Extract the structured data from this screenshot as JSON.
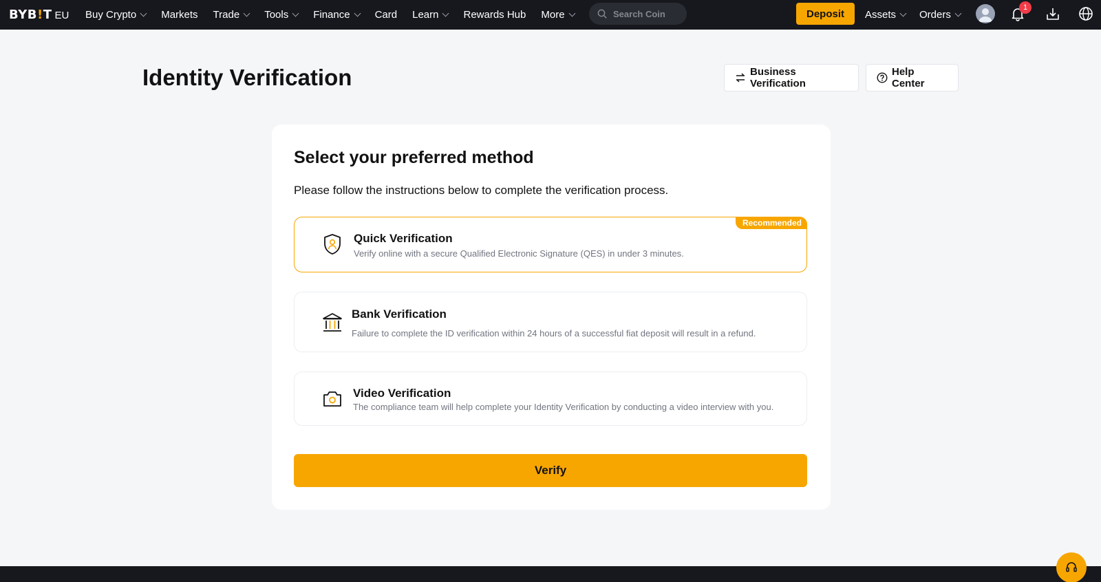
{
  "logo": {
    "brand_left": "BYB",
    "brand_dot": "!",
    "brand_right": "T",
    "region": "EU"
  },
  "nav": {
    "items": [
      {
        "label": "Buy Crypto",
        "dropdown": true
      },
      {
        "label": "Markets",
        "dropdown": false
      },
      {
        "label": "Trade",
        "dropdown": true
      },
      {
        "label": "Tools",
        "dropdown": true
      },
      {
        "label": "Finance",
        "dropdown": true
      },
      {
        "label": "Card",
        "dropdown": false
      },
      {
        "label": "Learn",
        "dropdown": true
      },
      {
        "label": "Rewards Hub",
        "dropdown": false
      },
      {
        "label": "More",
        "dropdown": true
      }
    ],
    "search_placeholder": "Search Coin",
    "deposit_label": "Deposit",
    "assets_label": "Assets",
    "orders_label": "Orders",
    "notification_count": "1",
    "icons": [
      "user-avatar-icon",
      "bell-icon",
      "download-icon",
      "globe-icon"
    ]
  },
  "page": {
    "title": "Identity Verification",
    "business_button": "Business Verification",
    "help_button": "Help Center"
  },
  "card": {
    "title": "Select your preferred method",
    "subtitle": "Please follow the instructions below to complete the verification process.",
    "options": [
      {
        "title": "Quick Verification",
        "desc": "Verify online with a secure Qualified Electronic Signature (QES) in under 3 minutes.",
        "tag": "Recommended",
        "icon": "shield-user-icon",
        "selected": true
      },
      {
        "title": "Bank Verification",
        "desc": "Failure to complete the ID verification within 24 hours of a successful fiat deposit will result in a refund.",
        "icon": "bank-icon",
        "selected": false
      },
      {
        "title": "Video Verification",
        "desc": "The compliance team will help complete your Identity Verification by conducting a video interview with you.",
        "icon": "camera-icon",
        "selected": false
      }
    ],
    "verify_label": "Verify"
  },
  "colors": {
    "accent": "#f7a600",
    "nav_bg": "#17181e",
    "page_bg": "#f5f6f8",
    "badge": "#f23c48"
  }
}
